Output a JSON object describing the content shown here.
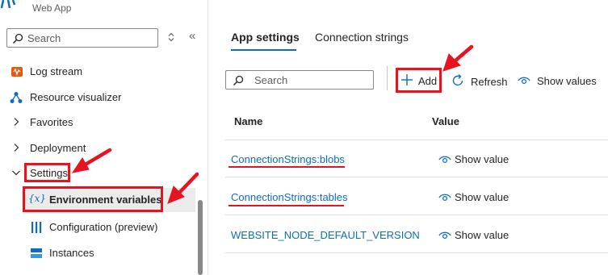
{
  "header": {
    "subtitle": "Web App"
  },
  "left": {
    "search": {
      "placeholder": "Search"
    },
    "items": [
      {
        "label": "Log stream",
        "icon": "log-stream-icon"
      },
      {
        "label": "Resource visualizer",
        "icon": "resource-visualizer-icon"
      },
      {
        "label": "Favorites",
        "icon": "chevron-right-icon"
      },
      {
        "label": "Deployment",
        "icon": "chevron-right-icon"
      },
      {
        "label": "Settings",
        "icon": "chevron-down-icon"
      },
      {
        "label": "Environment variables",
        "icon": "environment-variables-icon",
        "selected": true
      },
      {
        "label": "Configuration (preview)",
        "icon": "configuration-icon"
      },
      {
        "label": "Instances",
        "icon": "instances-icon"
      }
    ],
    "env_icon_text": "{x}"
  },
  "main": {
    "tabs": [
      {
        "label": "App settings",
        "active": true
      },
      {
        "label": "Connection strings",
        "active": false
      }
    ],
    "search": {
      "placeholder": "Search"
    },
    "toolbar": {
      "add_label": "Add",
      "refresh_label": "Refresh",
      "show_values_label": "Show values"
    },
    "table": {
      "columns": [
        "Name",
        "Value"
      ],
      "rows": [
        {
          "name": "ConnectionStrings:blobs",
          "value": "Show value"
        },
        {
          "name": "ConnectionStrings:tables",
          "value": "Show value"
        },
        {
          "name": "WEBSITE_NODE_DEFAULT_VERSION",
          "value": "Show value"
        }
      ]
    }
  },
  "colors": {
    "accent": "#0f6cbd",
    "annotation_red": "#e8131f",
    "selected_bg": "#ebebeb"
  }
}
